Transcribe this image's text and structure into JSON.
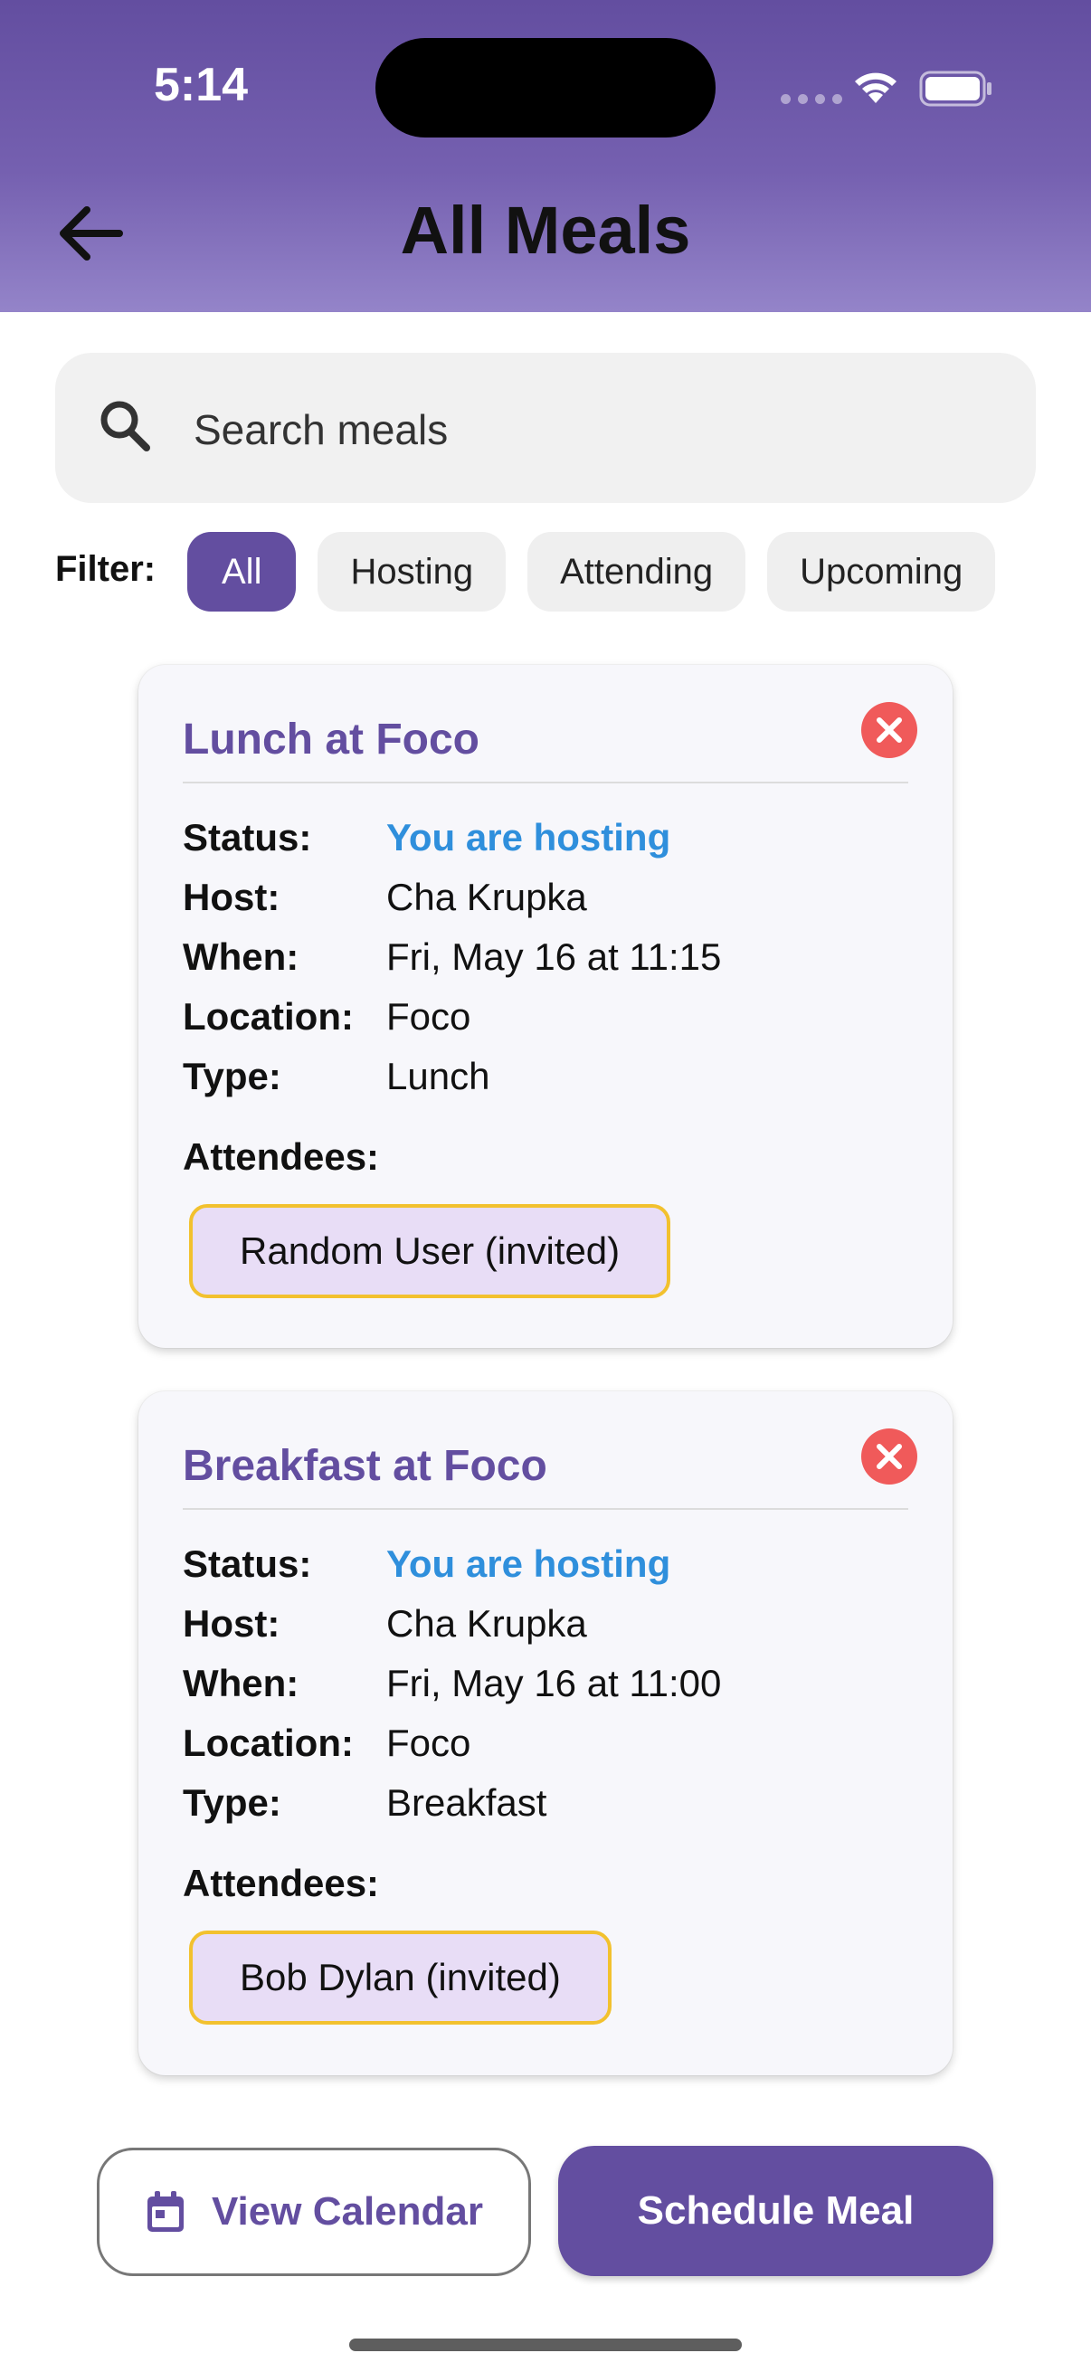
{
  "status_bar": {
    "time": "5:14"
  },
  "header": {
    "title": "All Meals"
  },
  "search": {
    "placeholder": "Search meals"
  },
  "filter": {
    "label": "Filter:",
    "options": [
      "All",
      "Hosting",
      "Attending",
      "Upcoming"
    ],
    "selected": "All"
  },
  "labels": {
    "status": "Status:",
    "host": "Host:",
    "when": "When:",
    "location": "Location:",
    "type": "Type:",
    "attendees": "Attendees:"
  },
  "meals": [
    {
      "title": "Lunch at Foco",
      "status": "You are hosting",
      "host": "Cha Krupka",
      "when": "Fri, May 16 at 11:15",
      "location": "Foco",
      "type": "Lunch",
      "attendees": [
        "Random User (invited)"
      ]
    },
    {
      "title": "Breakfast at Foco",
      "status": "You are hosting",
      "host": "Cha Krupka",
      "when": "Fri, May 16 at 11:00",
      "location": "Foco",
      "type": "Breakfast",
      "attendees": [
        "Bob Dylan (invited)"
      ]
    }
  ],
  "actions": {
    "view_calendar": "View Calendar",
    "schedule_meal": "Schedule Meal"
  },
  "colors": {
    "primary": "#634ea0",
    "hosting_status": "#2f8fdc",
    "delete": "#f05a5a",
    "attendee_border": "#f2c12e",
    "attendee_bg": "#e8ddf6"
  },
  "icons": {
    "back": "arrow-left-icon",
    "search": "search-icon",
    "delete": "close-circle-icon",
    "calendar": "calendar-icon"
  }
}
